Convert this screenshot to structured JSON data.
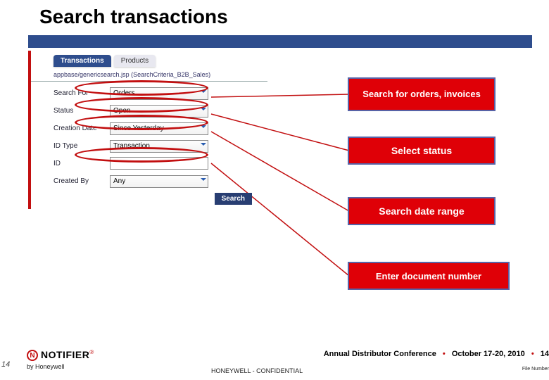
{
  "slide": {
    "title": "Search transactions"
  },
  "tabs": {
    "active": "Transactions",
    "inactive": "Products"
  },
  "breadcrumb": "appbase/genericsearch.jsp (SearchCriteria_B2B_Sales)",
  "form": {
    "search_for": {
      "label": "Search For",
      "value": "Orders"
    },
    "status": {
      "label": "Status",
      "value": "Open"
    },
    "creation_date": {
      "label": "Creation Date",
      "value": "Since Yesterday"
    },
    "id_type": {
      "label": "ID Type",
      "value": "Transaction"
    },
    "id": {
      "label": "ID",
      "value": ""
    },
    "created_by": {
      "label": "Created By",
      "value": "Any"
    },
    "search_button": "Search"
  },
  "callouts": {
    "c1": "Search for orders, invoices",
    "c2": "Select status",
    "c3": "Search date range",
    "c4": "Enter document number"
  },
  "footer": {
    "page_left": "14",
    "brand": "NOTIFIER",
    "byline": "by Honeywell",
    "conference": "Annual Distributor Conference",
    "date": "October 17-20, 2010",
    "page_right": "14",
    "file_number": "File Number",
    "confidential": "HONEYWELL - CONFIDENTIAL"
  }
}
